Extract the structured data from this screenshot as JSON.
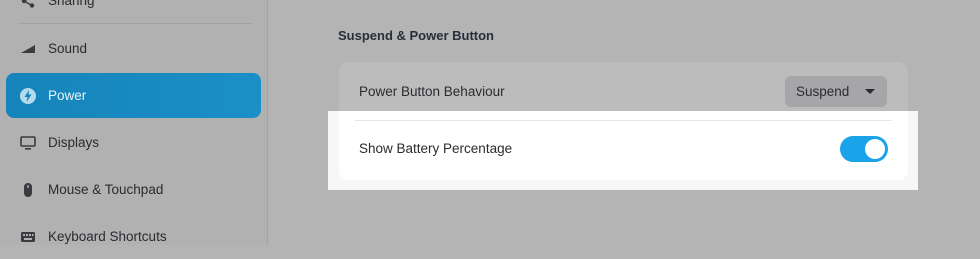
{
  "sidebar": {
    "items": [
      {
        "label": "Sharing",
        "icon": "share-icon"
      },
      {
        "label": "Sound",
        "icon": "speaker-icon"
      },
      {
        "label": "Power",
        "icon": "power-bolt-icon",
        "active": true
      },
      {
        "label": "Displays",
        "icon": "display-icon"
      },
      {
        "label": "Mouse & Touchpad",
        "icon": "mouse-icon"
      },
      {
        "label": "Keyboard Shortcuts",
        "icon": "keyboard-icon"
      }
    ]
  },
  "main": {
    "section_title": "Suspend & Power Button",
    "power_button": {
      "label": "Power Button Behaviour",
      "value": "Suspend"
    },
    "battery": {
      "label": "Show Battery Percentage",
      "enabled": true
    }
  },
  "colors": {
    "accent": "#1a8fc7",
    "toggle_on": "#1aa3e8"
  }
}
